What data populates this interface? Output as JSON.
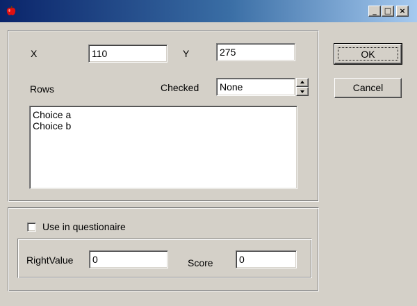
{
  "colors": {
    "title_gradient_start": "#0a246a",
    "title_gradient_end": "#a6caf0",
    "face": "#d4d0c8"
  },
  "titlebar": {
    "icon": "apple-icon",
    "minimize_label": "_",
    "maximize_label": "□",
    "close_label": "×"
  },
  "position": {
    "x_label": "X",
    "x_value": "110",
    "y_label": "Y",
    "y_value": "275"
  },
  "rows": {
    "label": "Rows",
    "checked_label": "Checked",
    "checked_value": "None",
    "items": [
      "Choice a",
      "Choice b"
    ]
  },
  "questionnaire": {
    "use_label": "Use in questionaire",
    "use_checked": false,
    "right_value_label": "RightValue",
    "right_value": "0",
    "score_label": "Score",
    "score_value": "0"
  },
  "buttons": {
    "ok": "OK",
    "cancel": "Cancel"
  }
}
